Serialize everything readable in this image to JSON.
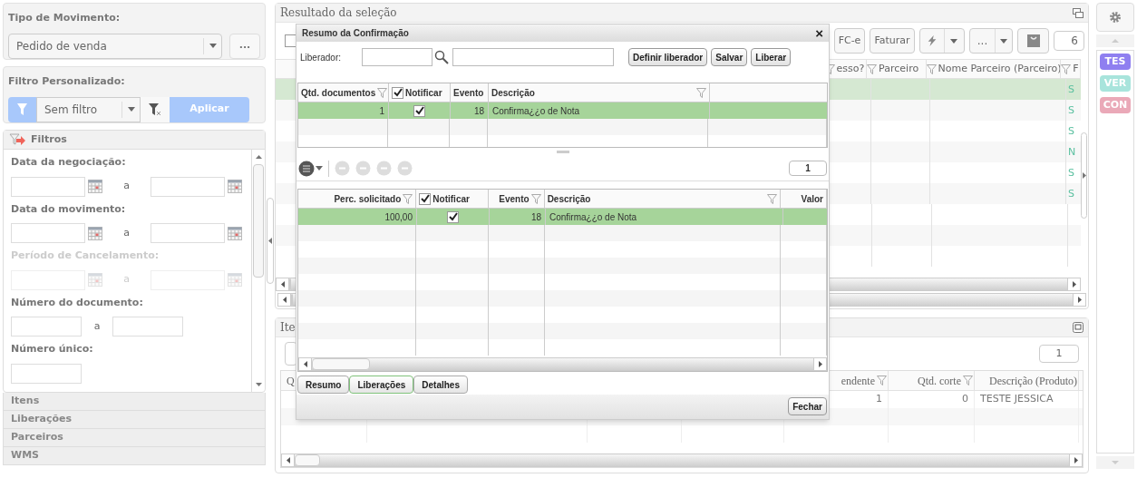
{
  "movement_type": {
    "label": "Tipo de Movimento:",
    "value": "Pedido de venda",
    "more": "..."
  },
  "custom_filter": {
    "label": "Filtro Personalizado:",
    "value": "Sem filtro",
    "apply": "Aplicar"
  },
  "filters": {
    "title": "Filtros",
    "items": [
      {
        "kind": "date_range",
        "label": "Data da negociação:",
        "separator": "a",
        "disabled": false
      },
      {
        "kind": "date_range",
        "label": "Data do movimento:",
        "separator": "a",
        "disabled": false
      },
      {
        "kind": "date_range",
        "label": "Período de Cancelamento:",
        "separator": "a",
        "disabled": true
      },
      {
        "kind": "number_range",
        "label": "Número do documento:",
        "separator": "a",
        "disabled": false
      },
      {
        "kind": "single",
        "label": "Número único:",
        "disabled": false
      }
    ]
  },
  "sections": [
    "Itens",
    "Liberações",
    "Parceiros",
    "WMS"
  ],
  "result": {
    "title": "Resultado da seleção",
    "toolbar": {
      "nfce": "FC-e",
      "invoice": "Faturar",
      "more": "...",
      "page": "6"
    },
    "columns": [
      {
        "label": "esso?"
      },
      {
        "label": "Parceiro"
      },
      {
        "label": "Nome Parceiro (Parceiro)"
      },
      {
        "label": "F"
      }
    ],
    "rows": [
      {
        "selected": true,
        "column_4": "S"
      },
      {
        "selected": false,
        "column_4": "S"
      },
      {
        "selected": false,
        "column_4": "S"
      },
      {
        "selected": false,
        "column_4": "N"
      },
      {
        "selected": false,
        "column_4": "S"
      },
      {
        "selected": false,
        "column_4": "S"
      },
      {
        "selected": false
      },
      {
        "selected": false
      },
      {
        "selected": false
      }
    ]
  },
  "items_panel": {
    "title": "Ite",
    "page": "1",
    "columns": [
      {
        "label": "Q"
      },
      {},
      {},
      {},
      {
        "label": "endente",
        "cell": "1"
      },
      {
        "label": "Qtd. corte",
        "cell": "0"
      },
      {
        "label": "Descrição (Produto)",
        "cell": "TESTE JESSICA"
      }
    ]
  },
  "dialog": {
    "title": "Resumo da Confirmação",
    "close": "×",
    "liberador_label": "Liberador:",
    "buttons": [
      "Definir liberador",
      "Salvar",
      "Liberar"
    ],
    "summary": {
      "columns": [
        "Qtd. documentos",
        "Notificar",
        "Evento",
        "Descrição"
      ],
      "notify_all": true,
      "rows": [
        {
          "selected": true,
          "qtd": "1",
          "notificar": true,
          "evento": "18",
          "descricao": "Confirma¿¿o de Nota"
        }
      ]
    },
    "page": "1",
    "releases": {
      "columns": [
        "Perc. solicitado",
        "Notificar",
        "Evento",
        "Descrição",
        "Valor"
      ],
      "notify_all": true,
      "rows": [
        {
          "selected": true,
          "perc": "100,00",
          "notificar": true,
          "evento": "18",
          "descricao": "Confirma¿¿o de Nota"
        }
      ]
    },
    "tabs": [
      {
        "label": "Resumo",
        "selected": false
      },
      {
        "label": "Liberações",
        "selected": true
      },
      {
        "label": "Detalhes",
        "selected": false
      }
    ],
    "footer_button": "Fechar"
  },
  "side_tags": [
    {
      "label": "TES",
      "color": "#8f7ff0"
    },
    {
      "label": "VER",
      "color": "#a8e4dc"
    },
    {
      "label": "CON",
      "color": "#eaa9b8"
    }
  ]
}
